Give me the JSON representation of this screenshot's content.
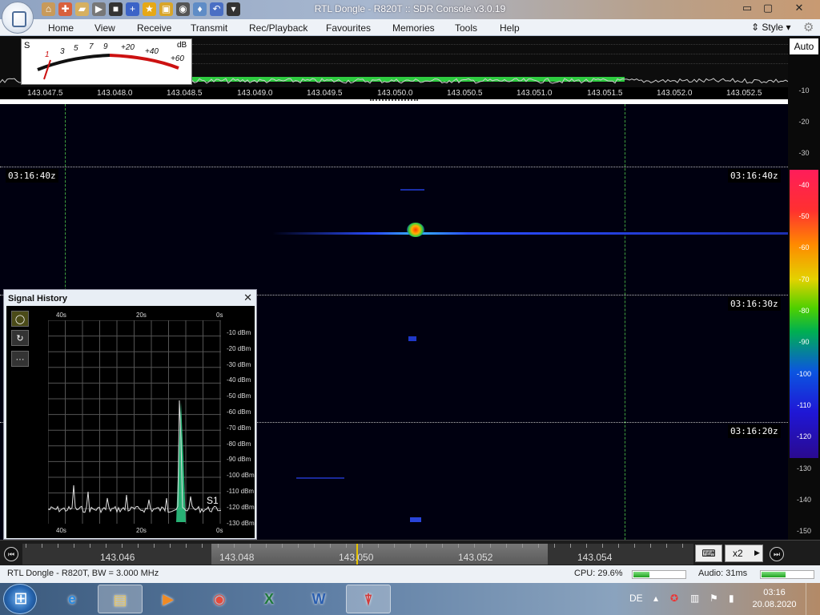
{
  "window": {
    "title": "RTL Dongle - R820T :: SDR Console v3.0.19",
    "minimize_glyph": "▭",
    "maximize_glyph": "▢",
    "close_glyph": "✕"
  },
  "quick_access": [
    {
      "icon": "home-icon",
      "glyph": "⌂",
      "color": "#c89a5a"
    },
    {
      "icon": "lifebuoy-icon",
      "glyph": "✚",
      "color": "#d9603b"
    },
    {
      "icon": "folder-icon",
      "glyph": "▰",
      "color": "#d6b060"
    },
    {
      "icon": "play-icon",
      "glyph": "▶",
      "color": "#777777"
    },
    {
      "icon": "stop-icon",
      "glyph": "■",
      "color": "#333333"
    },
    {
      "icon": "add-icon",
      "glyph": "+",
      "color": "#3b63c7"
    },
    {
      "icon": "star-icon",
      "glyph": "★",
      "color": "#e6a817"
    },
    {
      "icon": "lock-icon",
      "glyph": "▣",
      "color": "#d8a52a"
    },
    {
      "icon": "camera-icon",
      "glyph": "◉",
      "color": "#555555"
    },
    {
      "icon": "drop-icon",
      "glyph": "♦",
      "color": "#5f8cc6"
    },
    {
      "icon": "undo-icon",
      "glyph": "↶",
      "color": "#4a6fc4"
    },
    {
      "icon": "dropdown-icon",
      "glyph": "▾",
      "color": "#333333"
    }
  ],
  "menu": [
    "Home",
    "View",
    "Receive",
    "Transmit",
    "Rec/Playback",
    "Favourites",
    "Memories",
    "Tools",
    "Help"
  ],
  "style_label": "Style",
  "meter": {
    "s_label": "S",
    "db_label": "dB",
    "s_ticks": [
      "1",
      "3",
      "5",
      "7",
      "9"
    ],
    "db_ticks": [
      "+20",
      "+40",
      "+60"
    ]
  },
  "freq_axis": [
    "143.047.5",
    "143.048.0",
    "143.048.5",
    "143.049.0",
    "143.049.5",
    "143.050.0",
    "143.050.5",
    "143.051.0",
    "143.051.5",
    "143.052.0",
    "143.052.5"
  ],
  "right_scale": {
    "auto_label": "Auto",
    "top_ticks": [
      "-10",
      "-20",
      "-30"
    ],
    "color_ticks": [
      "-40",
      "-50",
      "-60",
      "-70",
      "-80",
      "-90",
      "-100",
      "-110",
      "-120"
    ],
    "bottom_ticks": [
      "-130",
      "-140",
      "-150"
    ]
  },
  "waterfall": {
    "timestamps": [
      "03:16:40z",
      "03:16:30z",
      "03:16:20z"
    ]
  },
  "signal_history": {
    "title": "Signal History",
    "close_glyph": "✕",
    "tools": [
      {
        "icon": "record-icon",
        "glyph": "◯"
      },
      {
        "icon": "refresh-icon",
        "glyph": "↻"
      },
      {
        "icon": "more-icon",
        "glyph": "···"
      }
    ],
    "time_ticks": [
      "40s",
      "20s",
      "0s"
    ],
    "dbm_ticks": [
      "-10 dBm",
      "-20 dBm",
      "-30 dBm",
      "-40 dBm",
      "-50 dBm",
      "-60 dBm",
      "-70 dBm",
      "-80 dBm",
      "-90 dBm",
      "-100 dBm",
      "-110 dBm",
      "-120 dBm",
      "-130 dBm"
    ],
    "series_label": "S1"
  },
  "tuning": {
    "labels": [
      "143.046",
      "143.048",
      "143.050",
      "143.052",
      "143.054"
    ],
    "zoom_label": "x2",
    "zoom_arrow": "▶",
    "keyboard_glyph": "⌨",
    "left_glyph": "⏮",
    "right_glyph": "⏭"
  },
  "status": {
    "device": "RTL Dongle - R820T, BW = 3.000 MHz",
    "cpu_label": "CPU: 29.6%",
    "cpu_fraction": 0.296,
    "audio_label": "Audio: 31ms",
    "audio_fraction": 0.45
  },
  "taskbar": {
    "apps": [
      {
        "icon": "internet-explorer-icon",
        "glyph": "e",
        "color": "#2a8be0"
      },
      {
        "icon": "file-explorer-icon",
        "glyph": "▤",
        "color": "#e6c25a"
      },
      {
        "icon": "media-player-icon",
        "glyph": "▶",
        "color": "#f08a24"
      },
      {
        "icon": "chrome-icon",
        "glyph": "◉",
        "color": "#e64a3b"
      },
      {
        "icon": "excel-icon",
        "glyph": "X",
        "color": "#1f7a3c"
      },
      {
        "icon": "word-icon",
        "glyph": "W",
        "color": "#2b5fb0"
      },
      {
        "icon": "sdr-console-icon",
        "glyph": "⍒",
        "color": "#d23a3a"
      }
    ],
    "language": "DE",
    "time": "03:16",
    "date": "20.08.2020"
  }
}
